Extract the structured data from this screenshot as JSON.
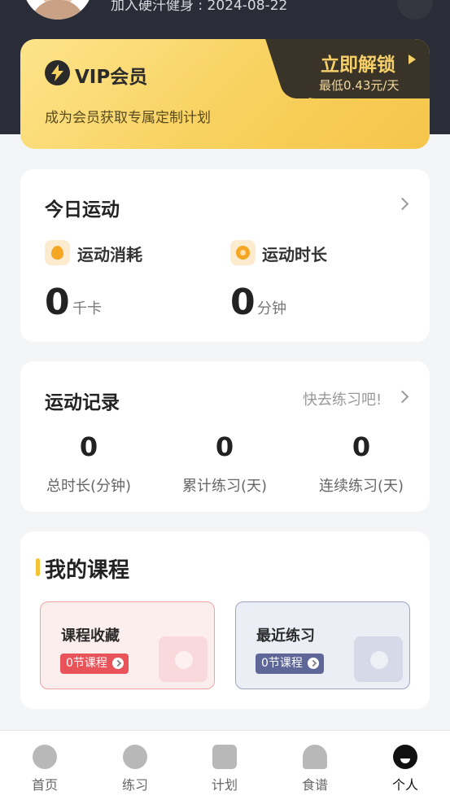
{
  "header": {
    "join_date_text": "加入硬汗健身 : 2024-08-22"
  },
  "vip": {
    "title": "VIP会员",
    "subtitle": "成为会员获取专属定制计划",
    "unlock_label": "立即解锁",
    "price_text": "最低0.43元/天"
  },
  "today": {
    "title": "今日运动",
    "stats": [
      {
        "label": "运动消耗",
        "value": "0",
        "unit": "千卡",
        "icon": "flame-icon"
      },
      {
        "label": "运动时长",
        "value": "0",
        "unit": "分钟",
        "icon": "stopwatch-icon"
      }
    ]
  },
  "records": {
    "title": "运动记录",
    "hint": "快去练习吧!",
    "items": [
      {
        "value": "0",
        "label": "总时长(分钟)"
      },
      {
        "value": "0",
        "label": "累计练习(天)"
      },
      {
        "value": "0",
        "label": "连续练习(天)"
      }
    ]
  },
  "courses": {
    "title": "我的课程",
    "favorites": {
      "title": "课程收藏",
      "count_text": "0节课程"
    },
    "recent": {
      "title": "最近练习",
      "count_text": "0节课程"
    }
  },
  "tabbar": {
    "items": [
      {
        "label": "首页",
        "icon": "pulse-icon",
        "active": false
      },
      {
        "label": "练习",
        "icon": "stopwatch-icon",
        "active": false
      },
      {
        "label": "计划",
        "icon": "calendar-icon",
        "active": false
      },
      {
        "label": "食谱",
        "icon": "cloche-icon",
        "active": false
      },
      {
        "label": "个人",
        "icon": "profile-icon",
        "active": true
      }
    ]
  },
  "colors": {
    "header_bg": "#2a2d38",
    "vip_gold": "#f8d15e",
    "accent_yellow": "#f6c233",
    "favorite_red": "#e9535a",
    "recent_indigo": "#5f6798"
  }
}
